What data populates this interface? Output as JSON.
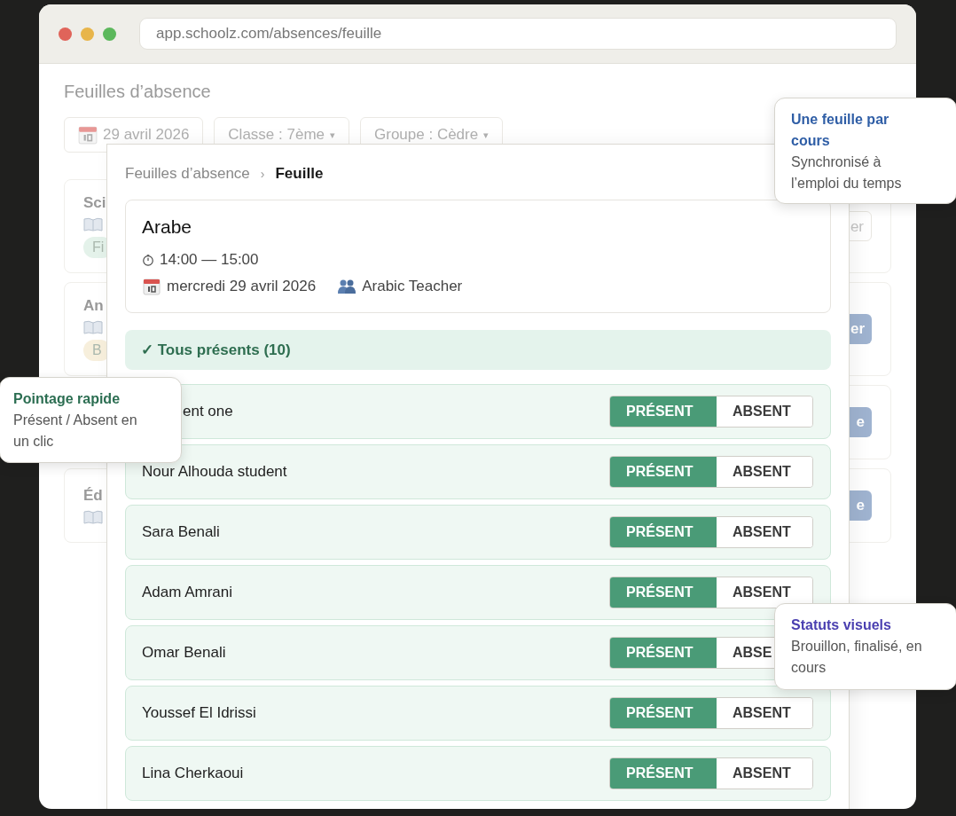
{
  "browser": {
    "url": "app.schoolz.com/absences/feuille"
  },
  "page": {
    "title": "Feuilles d’absence",
    "filters": [
      {
        "kind": "date",
        "label": "29 avril 2026"
      },
      {
        "kind": "select",
        "label": "Classe : 7ème",
        "caret": "▾"
      },
      {
        "kind": "select",
        "label": "Groupe : Cèdre",
        "caret": "▾"
      }
    ],
    "cards": [
      {
        "title": "Sci",
        "badge": {
          "label": "Fi",
          "color": "#e4f2ea"
        },
        "button": {
          "label": "er",
          "kind": "outline"
        }
      },
      {
        "title": "An",
        "badge": {
          "label": "B",
          "color": "#f7efdc"
        },
        "button": {
          "label": "er",
          "kind": "primary"
        }
      },
      {
        "button": {
          "label": "e",
          "kind": "primary"
        }
      },
      {
        "title": "Éd",
        "button": {
          "label": "e",
          "kind": "primary"
        }
      }
    ]
  },
  "sheet": {
    "breadcrumb": [
      {
        "label": "Feuilles d’absence",
        "selected": false
      },
      {
        "label": "Feuille",
        "selected": true
      }
    ],
    "separator": "›",
    "lesson": {
      "subject": "Arabe",
      "time": "14:00 — 15:00",
      "date": "mercredi 29 avril 2026",
      "teacher": "Arabic Teacher"
    },
    "all_present": "✓ Tous présents (10)",
    "students": [
      {
        "name": "ent one",
        "covered": true,
        "options": [
          {
            "label": "PRÉSENT",
            "selected": true
          },
          {
            "label": "ABSENT",
            "selected": false
          }
        ]
      },
      {
        "name": "Nour Alhouda student",
        "covered": false,
        "options": [
          {
            "label": "PRÉSENT",
            "selected": true
          },
          {
            "label": "ABSENT",
            "selected": false
          }
        ]
      },
      {
        "name": "Sara Benali",
        "covered": false,
        "options": [
          {
            "label": "PRÉSENT",
            "selected": true
          },
          {
            "label": "ABSENT",
            "selected": false
          }
        ]
      },
      {
        "name": "Adam Amrani",
        "covered": false,
        "options": [
          {
            "label": "PRÉSENT",
            "selected": true
          },
          {
            "label": "ABSENT",
            "selected": false
          }
        ]
      },
      {
        "name": "Omar Benali",
        "covered": false,
        "options": [
          {
            "label": "PRÉSENT",
            "selected": true
          },
          {
            "label": "ABSE",
            "selected": false
          }
        ]
      },
      {
        "name": "Youssef El Idrissi",
        "covered": false,
        "options": [
          {
            "label": "PRÉSENT",
            "selected": true
          },
          {
            "label": "ABSENT",
            "selected": false
          }
        ]
      },
      {
        "name": "Lina Cherkaoui",
        "covered": false,
        "options": [
          {
            "label": "PRÉSENT",
            "selected": true
          },
          {
            "label": "ABSENT",
            "selected": false
          }
        ]
      }
    ]
  },
  "callouts": [
    {
      "title": "Une feuille par cours",
      "text": "Synchronisé à l’emploi du temps",
      "color": "#2f5ea6"
    },
    {
      "title": "Pointage rapide",
      "text": "Présent / Absent en un clic",
      "color": "#2c6e52"
    },
    {
      "title": "Statuts visuels",
      "text": "Brouillon, finalisé, en cours",
      "color": "#4a3fb0"
    }
  ]
}
